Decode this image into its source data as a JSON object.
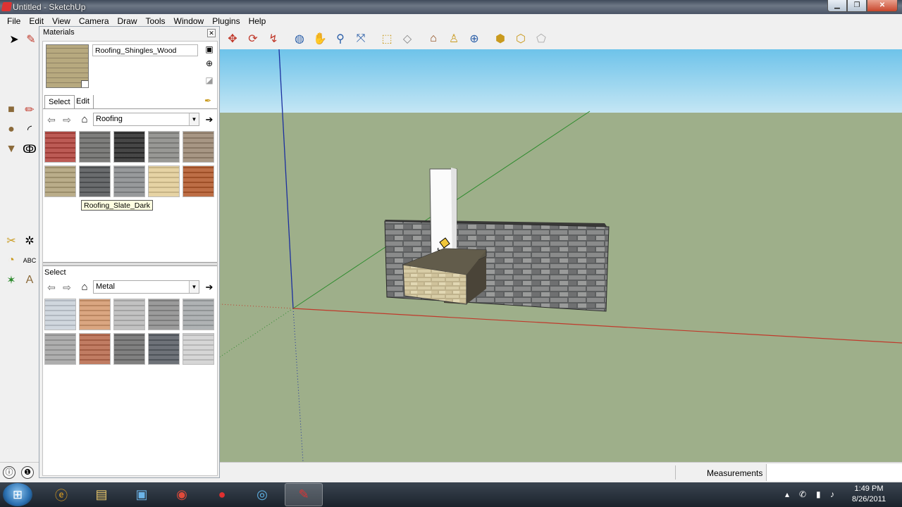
{
  "window": {
    "title": "Untitled - SketchUp",
    "controls": [
      "minimize",
      "maximize",
      "close"
    ]
  },
  "menu": [
    "File",
    "Edit",
    "View",
    "Camera",
    "Draw",
    "Tools",
    "Window",
    "Plugins",
    "Help"
  ],
  "toolbar": {
    "icons": [
      "move-icon",
      "rotate-icon",
      "follow-me-icon",
      "orbit-icon",
      "pan-icon",
      "zoom-icon",
      "zoom-extents-icon",
      "iso-view-icon",
      "top-view-icon",
      "front-view-icon",
      "right-view-icon",
      "back-view-icon",
      "left-view-icon",
      "shaded-icon",
      "xray-icon",
      "hidden-line-icon"
    ]
  },
  "materials_panel": {
    "title": "Materials",
    "current_material": "Roofing_Shingles_Wood",
    "tabs": {
      "select": "Select",
      "edit": "Edit"
    },
    "top_collection": "Roofing",
    "tooltip": "Roofing_Slate_Dark",
    "bottom_label": "Select",
    "bottom_collection": "Metal",
    "roofing_swatches": [
      {
        "name": "roofing-metal-red",
        "color": "#b3443e"
      },
      {
        "name": "roofing-shingles-gray",
        "color": "#6c6c6a"
      },
      {
        "name": "roofing-scallop-black",
        "color": "#2d2d2d"
      },
      {
        "name": "roofing-shingles-light",
        "color": "#8a8a86"
      },
      {
        "name": "roofing-shingles-brown",
        "color": "#9b8773"
      },
      {
        "name": "roofing-shingles-wood",
        "color": "#b0a27a"
      },
      {
        "name": "roofing-slate-dark",
        "color": "#55585a"
      },
      {
        "name": "roofing-slate-gray",
        "color": "#8a8c8e"
      },
      {
        "name": "roofing-tile-sand",
        "color": "#e2cd98"
      },
      {
        "name": "roofing-tile-terracotta",
        "color": "#b45a2c"
      }
    ],
    "metal_swatches": [
      {
        "name": "metal-silver",
        "color": "#c9d2da"
      },
      {
        "name": "metal-copper-pattern",
        "color": "#d59a70"
      },
      {
        "name": "metal-corrugated",
        "color": "#b9b9b9"
      },
      {
        "name": "metal-panel-x",
        "color": "#8d8d8d"
      },
      {
        "name": "metal-brushed",
        "color": "#a4a8aa"
      },
      {
        "name": "metal-galvanized",
        "color": "#a3a3a3"
      },
      {
        "name": "metal-rust",
        "color": "#b86a4d"
      },
      {
        "name": "metal-dark-gray",
        "color": "#6f6f6f"
      },
      {
        "name": "metal-mesh",
        "color": "#5a5f66"
      },
      {
        "name": "metal-diamond-plate",
        "color": "#d0d0d0"
      }
    ]
  },
  "status": {
    "measurements_label": "Measurements",
    "measurements_value": ""
  },
  "taskbar": {
    "clock_time": "1:49 PM",
    "clock_date": "8/26/2011",
    "apps": [
      "internet-explorer-icon",
      "explorer-icon",
      "notepad-icon",
      "chrome-icon",
      "record-icon",
      "camera-icon",
      "sketchup-icon"
    ]
  },
  "colors": {
    "sky": "#a8d8ee",
    "ground": "#9fb08b",
    "x_axis": "#c0392b",
    "y_axis": "#2e8b2e",
    "z_axis": "#1b2f9f"
  }
}
